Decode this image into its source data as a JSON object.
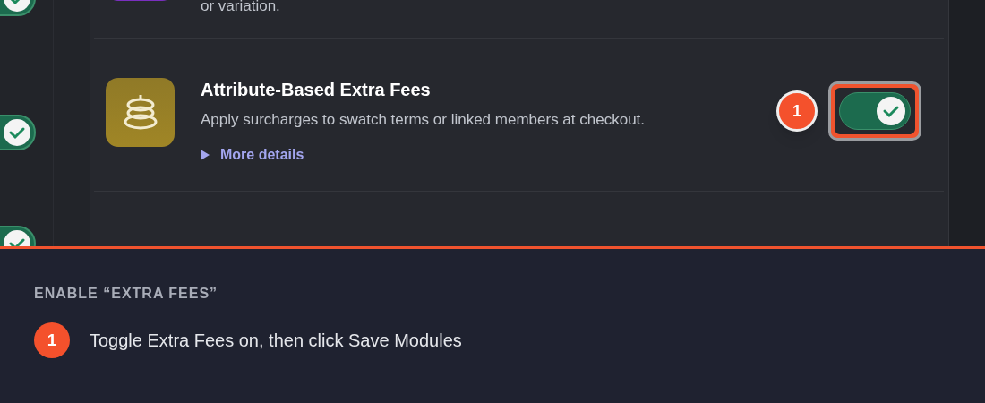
{
  "sidebar": {
    "toggles": [
      {
        "checked": true
      },
      {
        "checked": true
      },
      {
        "checked": true
      }
    ]
  },
  "modules": [
    {
      "description": "or variation.",
      "color": "#7a2fc0"
    },
    {
      "title": "Attribute-Based Extra Fees",
      "description": "Apply surcharges to swatch terms or linked members at checkout.",
      "details_link": "More details",
      "color": "#a08626",
      "enabled": true,
      "callout": "1"
    }
  ],
  "tutorial": {
    "heading": "ENABLE “EXTRA FEES”",
    "steps": [
      {
        "number": "1",
        "text": "Toggle Extra Fees on, then click Save Modules"
      }
    ]
  }
}
